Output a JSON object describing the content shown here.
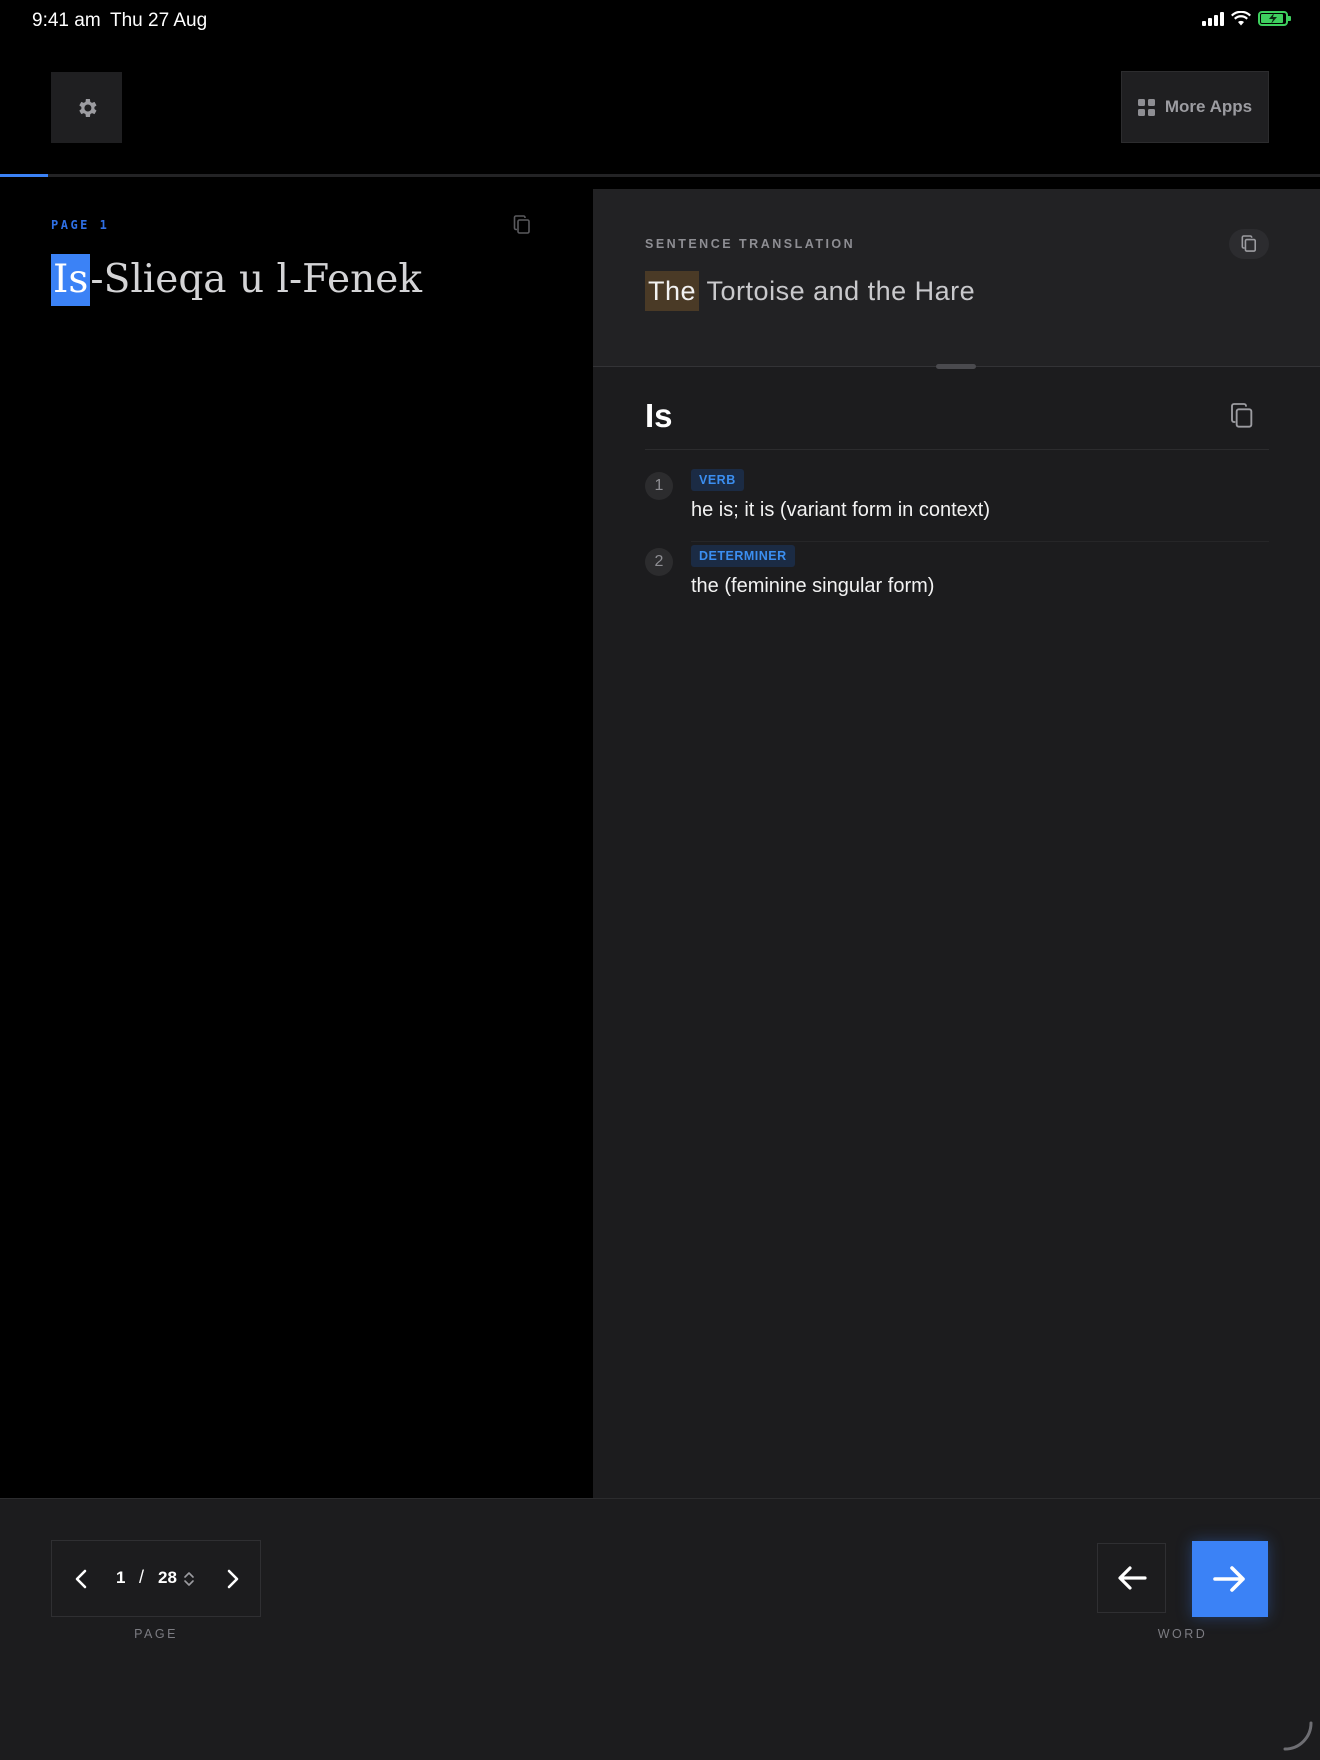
{
  "status_bar": {
    "time": "9:41 am",
    "date": "Thu 27 Aug"
  },
  "toolbar": {
    "settings_icon": "gear-icon",
    "more_apps_label": "More Apps"
  },
  "reader": {
    "progress_percent": 3.6,
    "page_label": "PAGE 1",
    "title_highlight": "Is",
    "title_rest": "-Slieqa u l-Fenek"
  },
  "translation": {
    "label": "SENTENCE TRANSLATION",
    "highlight": "The",
    "rest": " Tortoise and the Hare"
  },
  "dictionary": {
    "word": "Is",
    "definitions": [
      {
        "number": "1",
        "pos": "VERB",
        "text": "he is; it is (variant form in context)"
      },
      {
        "number": "2",
        "pos": "DETERMINER",
        "text": "the (feminine singular form)"
      }
    ]
  },
  "footer": {
    "current_page": "1",
    "separator": "/",
    "total_pages": "28",
    "page_caption": "PAGE",
    "word_caption": "WORD"
  },
  "colors": {
    "accent": "#3b82f6",
    "translation_highlight": "#4a3a26",
    "battery": "#3ecf5e"
  }
}
